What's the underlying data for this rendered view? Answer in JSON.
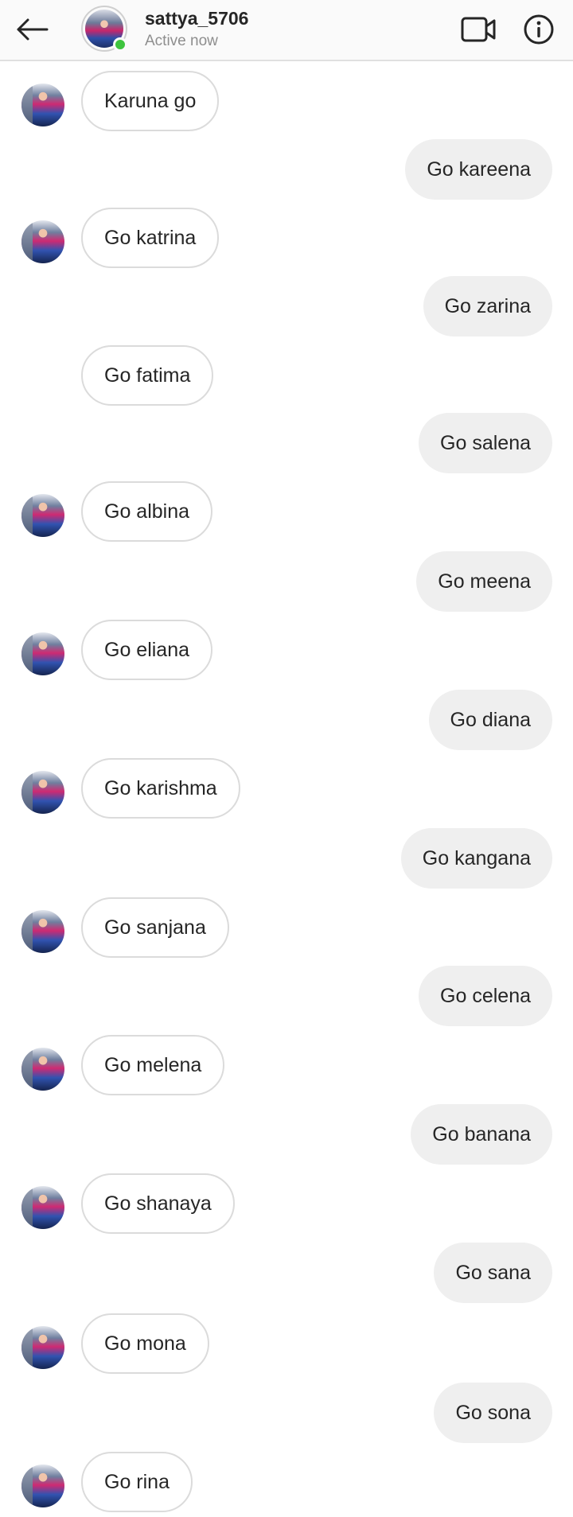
{
  "header": {
    "username": "sattya_5706",
    "status": "Active now",
    "icons": {
      "back": "arrow-left-icon",
      "video": "video-camera-icon",
      "info": "info-icon"
    },
    "online_color": "#3ec43e"
  },
  "messages": [
    {
      "from": "them",
      "text": "Karuna go",
      "avatar": true
    },
    {
      "from": "me",
      "text": "Go kareena"
    },
    {
      "from": "them",
      "text": "Go katrina",
      "avatar": true
    },
    {
      "from": "me",
      "text": "Go zarina"
    },
    {
      "from": "them",
      "text": "Go fatima",
      "avatar": false
    },
    {
      "from": "me",
      "text": "Go salena"
    },
    {
      "from": "them",
      "text": "Go albina",
      "avatar": true
    },
    {
      "from": "me",
      "text": "Go meena"
    },
    {
      "from": "them",
      "text": "Go eliana",
      "avatar": true
    },
    {
      "from": "me",
      "text": "Go diana"
    },
    {
      "from": "them",
      "text": "Go karishma",
      "avatar": true
    },
    {
      "from": "me",
      "text": "Go kangana"
    },
    {
      "from": "them",
      "text": "Go sanjana",
      "avatar": true
    },
    {
      "from": "me",
      "text": "Go celena"
    },
    {
      "from": "them",
      "text": "Go melena",
      "avatar": true
    },
    {
      "from": "me",
      "text": "Go banana"
    },
    {
      "from": "them",
      "text": "Go shanaya",
      "avatar": true
    },
    {
      "from": "me",
      "text": "Go sana"
    },
    {
      "from": "them",
      "text": "Go mona",
      "avatar": true
    },
    {
      "from": "me",
      "text": "Go sona"
    },
    {
      "from": "them",
      "text": "Go rina",
      "avatar": true
    }
  ]
}
